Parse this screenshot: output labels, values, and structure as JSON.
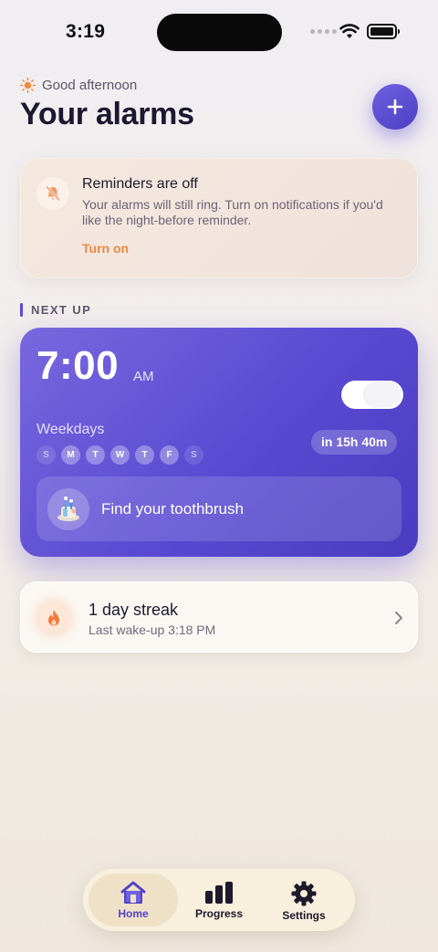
{
  "status_bar": {
    "time": "3:19"
  },
  "header": {
    "greeting": "Good afternoon",
    "title": "Your alarms",
    "add_icon": "plus-icon"
  },
  "notice": {
    "title": "Reminders are off",
    "body": "Your alarms will still ring. Turn on notifications if you'd like the night-before reminder.",
    "action": "Turn on",
    "icon": "bell-off-icon"
  },
  "section": {
    "label": "NEXT UP"
  },
  "alarm": {
    "time": "7:00",
    "period": "AM",
    "enabled": true,
    "repeat": "Weekdays",
    "days": [
      {
        "letter": "S",
        "active": false
      },
      {
        "letter": "M",
        "active": true
      },
      {
        "letter": "T",
        "active": true
      },
      {
        "letter": "W",
        "active": true
      },
      {
        "letter": "T",
        "active": true
      },
      {
        "letter": "F",
        "active": true
      },
      {
        "letter": "S",
        "active": false
      }
    ],
    "countdown": "in 15h 40m",
    "mission": "Find your toothbrush"
  },
  "streak": {
    "title": "1 day streak",
    "subtitle": "Last wake-up 3:18 PM",
    "icon": "flame-icon"
  },
  "tabs": [
    {
      "label": "Home",
      "icon": "house-icon",
      "active": true
    },
    {
      "label": "Progress",
      "icon": "bar-chart-icon",
      "active": false
    },
    {
      "label": "Settings",
      "icon": "gear-icon",
      "active": false
    }
  ],
  "colors": {
    "accent": "#5b4bd0",
    "warning": "#ec8a45",
    "tab_bar": "#f8efdc"
  }
}
